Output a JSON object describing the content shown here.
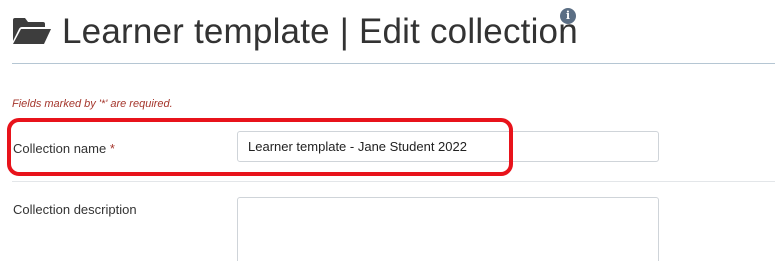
{
  "header": {
    "title": "Learner template | Edit collection",
    "icon": "folder-open-icon",
    "info_icon": "info-icon",
    "info_glyph": "i"
  },
  "form": {
    "required_note": "Fields marked by '*' are required.",
    "collection_name": {
      "label": "Collection name",
      "required_marker": "*",
      "value": "Learner template - Jane Student 2022"
    },
    "collection_description": {
      "label": "Collection description",
      "value": ""
    }
  },
  "annotation": {
    "color": "#e8131b"
  }
}
